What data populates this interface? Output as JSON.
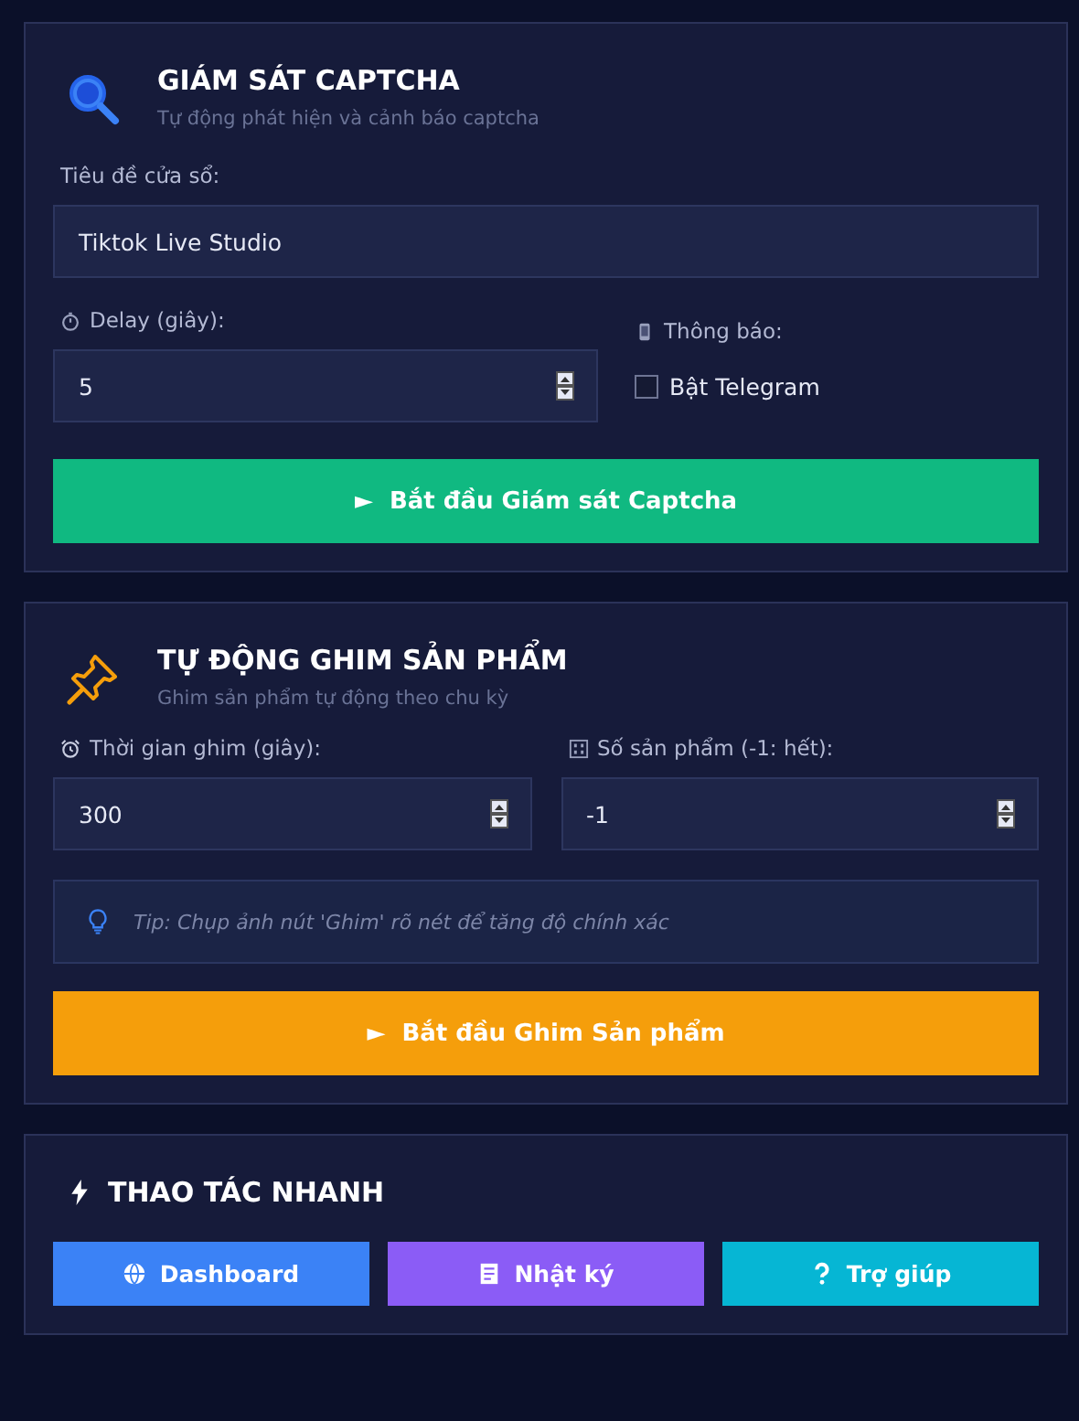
{
  "captcha_panel": {
    "title": "GIÁM SÁT CAPTCHA",
    "subtitle": "Tự động phát hiện và cảnh báo captcha",
    "window_title_label": "Tiêu đề cửa sổ:",
    "window_title_value": "Tiktok Live Studio",
    "delay_label": "Delay (giây):",
    "delay_value": "5",
    "notify_label": "Thông báo:",
    "telegram": {
      "label": "Bật Telegram",
      "checked": false
    },
    "start_button": "Bắt đầu Giám sát Captcha",
    "button_icon": "►"
  },
  "pin_panel": {
    "title": "TỰ ĐỘNG GHIM SẢN PHẨM",
    "subtitle": "Ghim sản phẩm tự động theo chu kỳ",
    "interval_label": "Thời gian ghim (giây):",
    "interval_value": "300",
    "count_label": "Số sản phẩm (-1: hết):",
    "count_value": "-1",
    "tip": "Tip: Chụp ảnh nút 'Ghim' rõ nét để tăng độ chính xác",
    "start_button": "Bắt đầu Ghim Sản phẩm",
    "button_icon": "►"
  },
  "quick_actions": {
    "title": "THAO TÁC NHANH",
    "buttons": [
      {
        "label": "Dashboard",
        "kind": "globe",
        "color": "#3b82f6"
      },
      {
        "label": "Nhật ký",
        "kind": "notes",
        "color": "#8b5cf6"
      },
      {
        "label": "Trợ giúp",
        "kind": "help",
        "color": "#06b6d4"
      }
    ]
  }
}
